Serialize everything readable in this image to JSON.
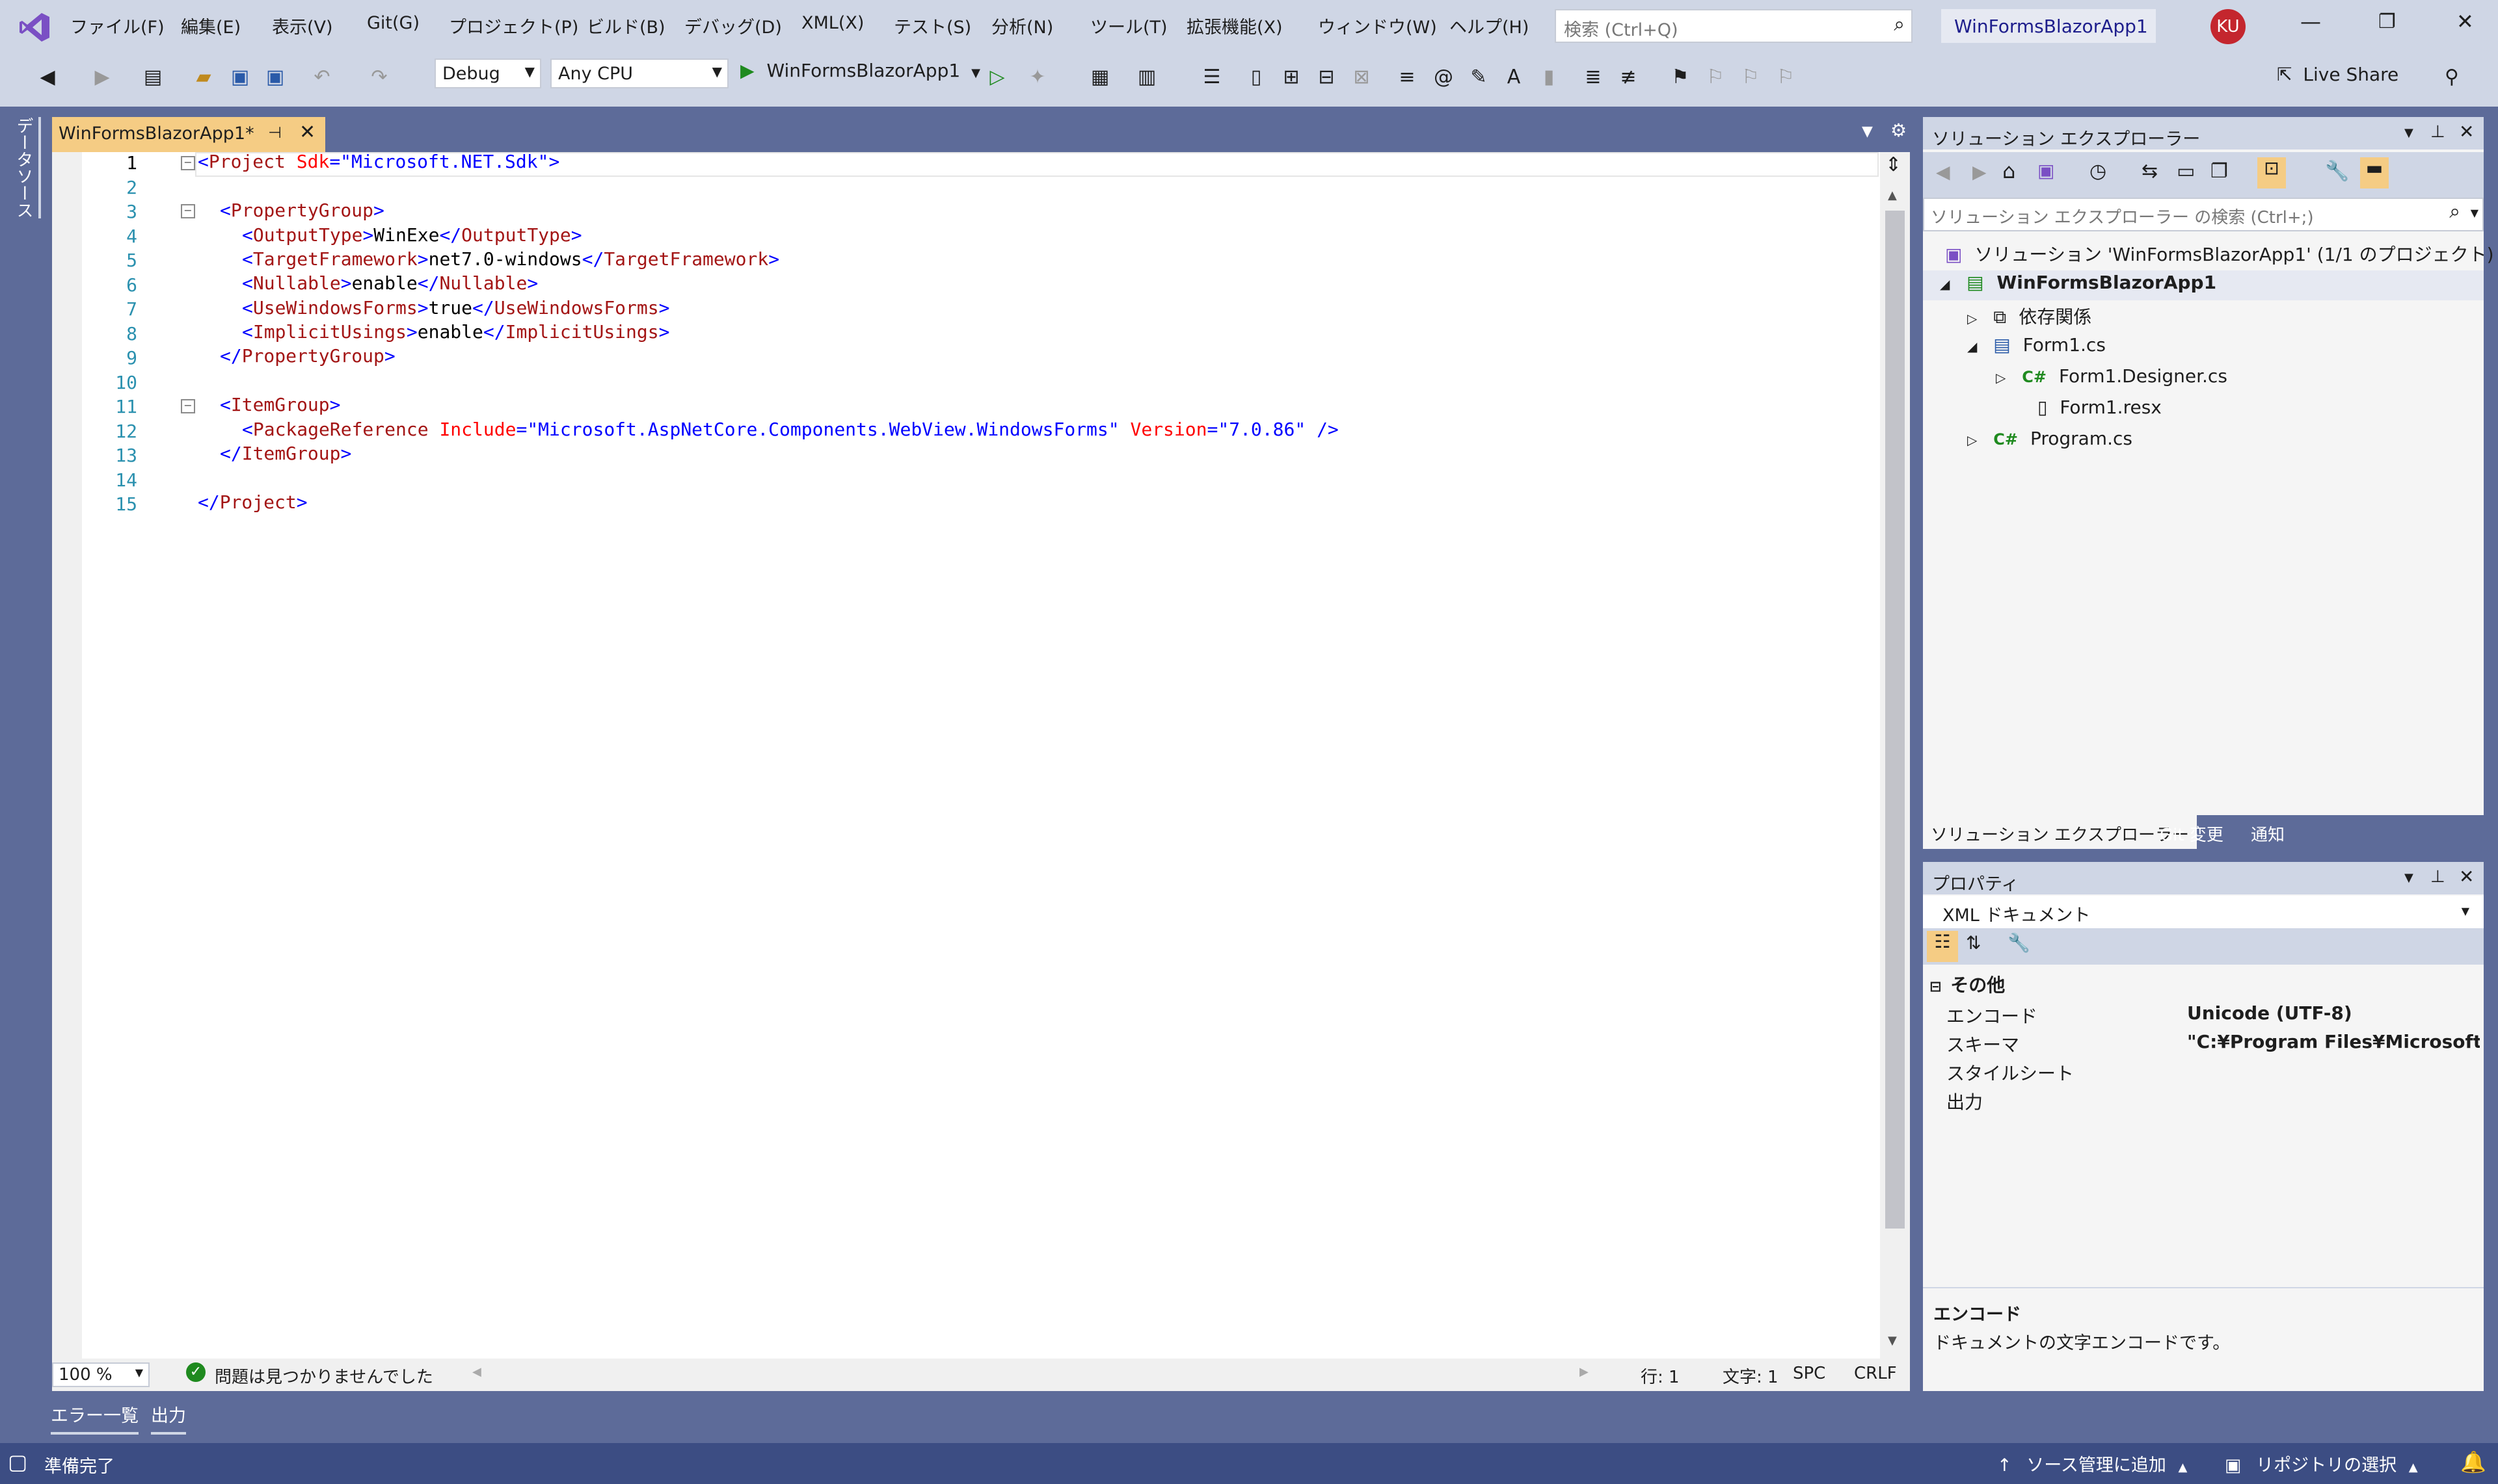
{
  "titlebar": {
    "menus": [
      "ファイル(F)",
      "編集(E)",
      "表示(V)",
      "Git(G)",
      "プロジェクト(P)",
      "ビルド(B)",
      "デバッグ(D)",
      "XML(X)",
      "テスト(S)",
      "分析(N)",
      "ツール(T)",
      "拡張機能(X)",
      "ウィンドウ(W)",
      "ヘルプ(H)"
    ],
    "search_placeholder": "検索 (Ctrl+Q)",
    "solution_name": "WinFormsBlazorApp1",
    "user_initials": "KU"
  },
  "toolbar": {
    "config": "Debug",
    "platform": "Any CPU",
    "run_target": "WinFormsBlazorApp1",
    "live_share": "Live Share"
  },
  "left_strip": {
    "label": "データソース"
  },
  "editor": {
    "tab_title": "WinFormsBlazorApp1*",
    "lines": [
      {
        "n": "1"
      },
      {
        "n": "2"
      },
      {
        "n": "3"
      },
      {
        "n": "4"
      },
      {
        "n": "5"
      },
      {
        "n": "6"
      },
      {
        "n": "7"
      },
      {
        "n": "8"
      },
      {
        "n": "9"
      },
      {
        "n": "10"
      },
      {
        "n": "11"
      },
      {
        "n": "12"
      },
      {
        "n": "13"
      },
      {
        "n": "14"
      },
      {
        "n": "15"
      }
    ],
    "code": {
      "l1_tag": "Project",
      "l1_attr": "Sdk",
      "l1_val": "\"Microsoft.NET.Sdk\"",
      "propertygroup": "PropertyGroup",
      "outputtype": "OutputType",
      "outputtype_val": "WinExe",
      "targetframework": "TargetFramework",
      "targetframework_val": "net7.0-windows",
      "nullable": "Nullable",
      "nullable_val": "enable",
      "usewinforms": "UseWindowsForms",
      "usewinforms_val": "true",
      "implicitusings": "ImplicitUsings",
      "implicitusings_val": "enable",
      "itemgroup": "ItemGroup",
      "packageref": "PackageReference",
      "include_attr": "Include",
      "include_val": "\"Microsoft.AspNetCore.Components.WebView.WindowsForms\"",
      "version_attr": "Version",
      "version_val": "\"7.0.86\""
    },
    "status": {
      "zoom": "100 %",
      "issues": "問題は見つかりませんでした",
      "line": "行: 1",
      "col": "文字: 1",
      "spc": "SPC",
      "crlf": "CRLF"
    }
  },
  "solution_explorer": {
    "title": "ソリューション エクスプローラー",
    "search_placeholder": "ソリューション エクスプローラー の検索 (Ctrl+;)",
    "solution_label": "ソリューション 'WinFormsBlazorApp1' (1/1 のプロジェクト)",
    "project": "WinFormsBlazorApp1",
    "dependencies": "依存関係",
    "form1": "Form1.cs",
    "form1_designer": "Form1.Designer.cs",
    "form1_resx": "Form1.resx",
    "program": "Program.cs",
    "tabs": [
      "ソリューション エクスプローラー",
      "Git 変更",
      "通知"
    ]
  },
  "properties": {
    "title": "プロパティ",
    "object": "XML ドキュメント",
    "category": "その他",
    "rows": [
      {
        "name": "エンコード",
        "value": "Unicode (UTF-8)"
      },
      {
        "name": "スキーマ",
        "value": "\"C:¥Program Files¥Microsoft Visu"
      },
      {
        "name": "スタイルシート",
        "value": ""
      },
      {
        "name": "出力",
        "value": ""
      }
    ],
    "desc_title": "エンコード",
    "desc_text": "ドキュメントの文字エンコードです。"
  },
  "bottom_tabs": [
    "エラー一覧",
    "出力"
  ],
  "statusbar": {
    "ready": "準備完了",
    "source_control": "ソース管理に追加",
    "repo": "リポジトリの選択"
  }
}
